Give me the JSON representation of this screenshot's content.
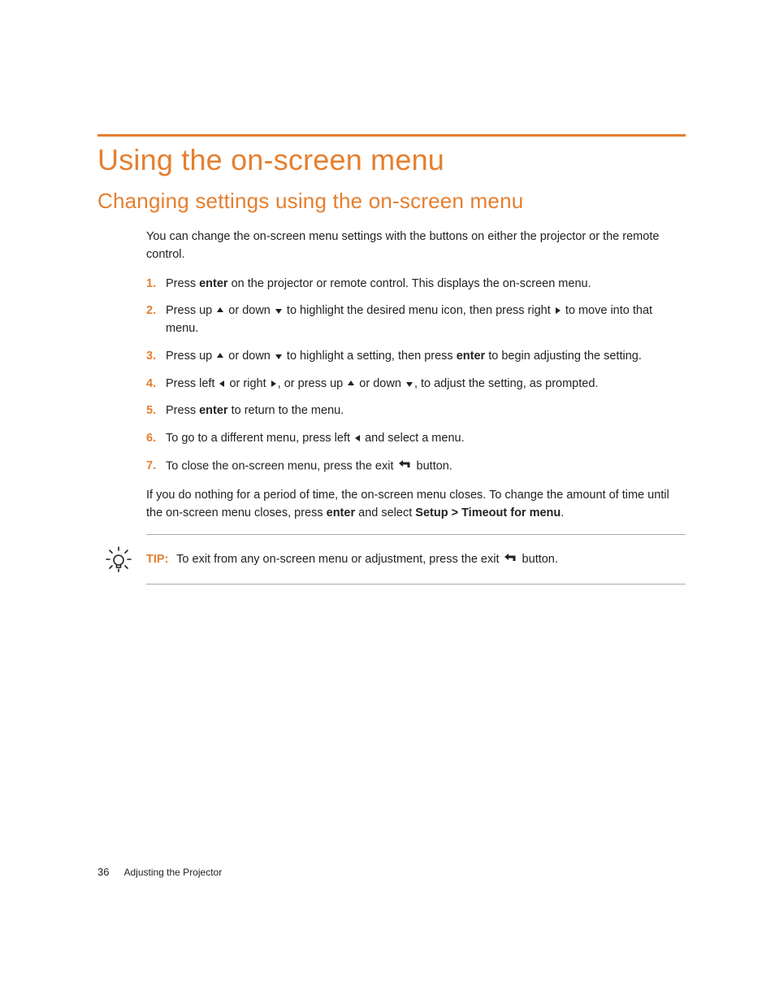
{
  "heading1": "Using the on-screen menu",
  "heading2": "Changing settings using the on-screen menu",
  "intro": "You can change the on-screen menu settings with the buttons on either the projector or the remote control.",
  "steps": [
    {
      "num": "1.",
      "segments": [
        {
          "t": "Press "
        },
        {
          "t": "enter",
          "b": true
        },
        {
          "t": " on the projector or remote control. This displays the on-screen menu."
        }
      ]
    },
    {
      "num": "2.",
      "segments": [
        {
          "t": "Press up "
        },
        {
          "icon": "arrow-up"
        },
        {
          "t": " or down "
        },
        {
          "icon": "arrow-down"
        },
        {
          "t": " to highlight the desired menu icon, then press right "
        },
        {
          "icon": "arrow-right"
        },
        {
          "t": " to move into that menu."
        }
      ]
    },
    {
      "num": "3.",
      "segments": [
        {
          "t": "Press up "
        },
        {
          "icon": "arrow-up"
        },
        {
          "t": " or down "
        },
        {
          "icon": "arrow-down"
        },
        {
          "t": " to highlight a setting, then press "
        },
        {
          "t": "enter",
          "b": true
        },
        {
          "t": " to begin adjusting the setting."
        }
      ]
    },
    {
      "num": "4.",
      "segments": [
        {
          "t": "Press left "
        },
        {
          "icon": "arrow-left"
        },
        {
          "t": " or right "
        },
        {
          "icon": "arrow-right"
        },
        {
          "t": ", or press up "
        },
        {
          "icon": "arrow-up"
        },
        {
          "t": " or down "
        },
        {
          "icon": "arrow-down"
        },
        {
          "t": ", to adjust the setting, as prompted."
        }
      ]
    },
    {
      "num": "5.",
      "segments": [
        {
          "t": "Press "
        },
        {
          "t": "enter",
          "b": true
        },
        {
          "t": " to return to the menu."
        }
      ]
    },
    {
      "num": "6.",
      "segments": [
        {
          "t": "To go to a different menu, press left "
        },
        {
          "icon": "arrow-left"
        },
        {
          "t": " and select a menu."
        }
      ]
    },
    {
      "num": "7.",
      "segments": [
        {
          "t": "To close the on-screen menu, press the exit "
        },
        {
          "icon": "exit"
        },
        {
          "t": " button."
        }
      ]
    }
  ],
  "outro_segments": [
    {
      "t": "If you do nothing for a period of time, the on-screen menu closes. To change the amount of time until the on-screen menu closes, press "
    },
    {
      "t": "enter",
      "b": true
    },
    {
      "t": " and select "
    },
    {
      "t": "Setup > Timeout for menu",
      "b": true
    },
    {
      "t": "."
    }
  ],
  "tip_label": "TIP:",
  "tip_segments": [
    {
      "t": "To exit from any on-screen menu or adjustment, press the exit "
    },
    {
      "icon": "exit"
    },
    {
      "t": " button."
    }
  ],
  "footer": {
    "page_number": "36",
    "section": "Adjusting the Projector"
  }
}
